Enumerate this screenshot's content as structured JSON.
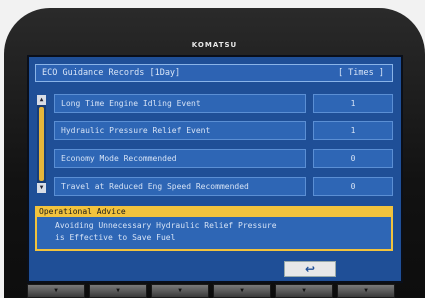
{
  "device": {
    "brand": "KOMATSU"
  },
  "screen": {
    "title": "ECO Guidance Records  [1Day]",
    "unit": "[ Times ]"
  },
  "records": [
    {
      "label": "Long Time Engine Idling Event",
      "value": "1"
    },
    {
      "label": "Hydraulic Pressure Relief Event",
      "value": "1"
    },
    {
      "label": "Economy Mode Recommended",
      "value": "0"
    },
    {
      "label": "Travel at Reduced Eng Speed Recommended",
      "value": "0"
    }
  ],
  "advice": {
    "header": "Operational Advice",
    "lines": [
      "Avoiding Unnecessary Hydraulic Relief Pressure",
      "is Effective to Save Fuel"
    ]
  },
  "controls": {
    "return_icon": "return-arrow-icon",
    "function_keys": [
      "▼",
      "▼",
      "▼",
      "▼",
      "▼",
      "▼"
    ]
  },
  "colors": {
    "screen_bg": "#1f4f97",
    "advice_accent": "#f2c33d"
  }
}
